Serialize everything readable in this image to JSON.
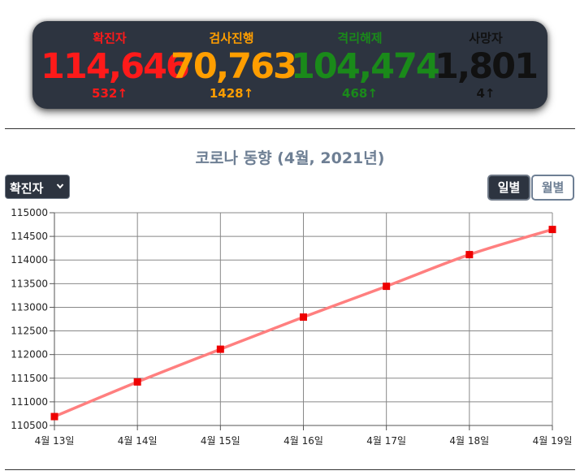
{
  "stats": [
    {
      "label": "확진자",
      "value": "114,646",
      "delta": "532↑",
      "color": "#ff1a1a"
    },
    {
      "label": "검사진행",
      "value": "70,763",
      "delta": "1428↑",
      "color": "#ff9e00"
    },
    {
      "label": "격리해제",
      "value": "104,474",
      "delta": "468↑",
      "color": "#1a8a1a"
    },
    {
      "label": "사망자",
      "value": "1,801",
      "delta": "4↑",
      "color": "#111111"
    }
  ],
  "chart_title": "코로나 동향 (4월, 2021년)",
  "controls": {
    "metric_select": "확진자",
    "daily_label": "일별",
    "monthly_label": "월별"
  },
  "chart_data": {
    "type": "line",
    "title": "코로나 동향 (4월, 2021년)",
    "categories": [
      "4월 13일",
      "4월 14일",
      "4월 15일",
      "4월 16일",
      "4월 17일",
      "4월 18일",
      "4월 19일"
    ],
    "values": [
      110688,
      111421,
      112113,
      112793,
      113444,
      114114,
      114646
    ],
    "y_ticks": [
      "110500",
      "111000",
      "111500",
      "112000",
      "112500",
      "113000",
      "113500",
      "114000",
      "114500",
      "115000"
    ],
    "ylim": [
      110500,
      115000
    ],
    "line_color": "#ff7f7f",
    "marker_color": "#ee0000",
    "grid": true
  }
}
